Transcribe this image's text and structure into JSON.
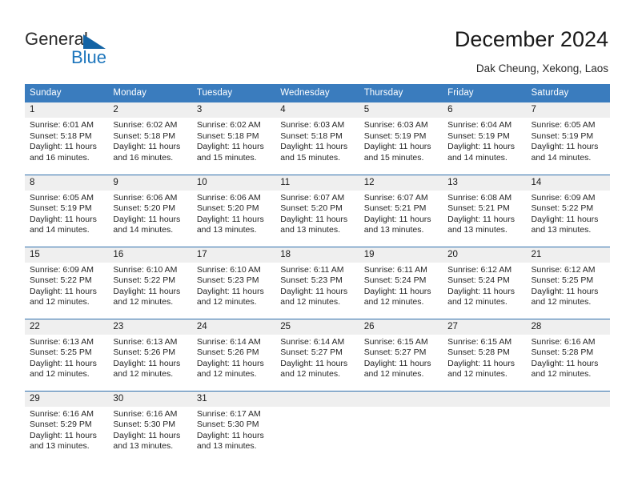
{
  "brand": {
    "name_part1": "General",
    "name_part2": "Blue",
    "triangle_icon": "brand-triangle-icon",
    "color_dark": "#2b2b2b",
    "color_blue": "#1c75bc"
  },
  "header": {
    "title": "December 2024",
    "subtitle": "Dak Cheung, Xekong, Laos",
    "accent_color": "#3a7cbe",
    "row_separator_color": "#2f6fad",
    "daynum_band_color": "#efefef"
  },
  "calendar": {
    "weekday_headers": [
      "Sunday",
      "Monday",
      "Tuesday",
      "Wednesday",
      "Thursday",
      "Friday",
      "Saturday"
    ],
    "weeks": [
      [
        {
          "day": "1",
          "sunrise": "Sunrise: 6:01 AM",
          "sunset": "Sunset: 5:18 PM",
          "daylight_line1": "Daylight: 11 hours",
          "daylight_line2": "and 16 minutes."
        },
        {
          "day": "2",
          "sunrise": "Sunrise: 6:02 AM",
          "sunset": "Sunset: 5:18 PM",
          "daylight_line1": "Daylight: 11 hours",
          "daylight_line2": "and 16 minutes."
        },
        {
          "day": "3",
          "sunrise": "Sunrise: 6:02 AM",
          "sunset": "Sunset: 5:18 PM",
          "daylight_line1": "Daylight: 11 hours",
          "daylight_line2": "and 15 minutes."
        },
        {
          "day": "4",
          "sunrise": "Sunrise: 6:03 AM",
          "sunset": "Sunset: 5:18 PM",
          "daylight_line1": "Daylight: 11 hours",
          "daylight_line2": "and 15 minutes."
        },
        {
          "day": "5",
          "sunrise": "Sunrise: 6:03 AM",
          "sunset": "Sunset: 5:19 PM",
          "daylight_line1": "Daylight: 11 hours",
          "daylight_line2": "and 15 minutes."
        },
        {
          "day": "6",
          "sunrise": "Sunrise: 6:04 AM",
          "sunset": "Sunset: 5:19 PM",
          "daylight_line1": "Daylight: 11 hours",
          "daylight_line2": "and 14 minutes."
        },
        {
          "day": "7",
          "sunrise": "Sunrise: 6:05 AM",
          "sunset": "Sunset: 5:19 PM",
          "daylight_line1": "Daylight: 11 hours",
          "daylight_line2": "and 14 minutes."
        }
      ],
      [
        {
          "day": "8",
          "sunrise": "Sunrise: 6:05 AM",
          "sunset": "Sunset: 5:19 PM",
          "daylight_line1": "Daylight: 11 hours",
          "daylight_line2": "and 14 minutes."
        },
        {
          "day": "9",
          "sunrise": "Sunrise: 6:06 AM",
          "sunset": "Sunset: 5:20 PM",
          "daylight_line1": "Daylight: 11 hours",
          "daylight_line2": "and 14 minutes."
        },
        {
          "day": "10",
          "sunrise": "Sunrise: 6:06 AM",
          "sunset": "Sunset: 5:20 PM",
          "daylight_line1": "Daylight: 11 hours",
          "daylight_line2": "and 13 minutes."
        },
        {
          "day": "11",
          "sunrise": "Sunrise: 6:07 AM",
          "sunset": "Sunset: 5:20 PM",
          "daylight_line1": "Daylight: 11 hours",
          "daylight_line2": "and 13 minutes."
        },
        {
          "day": "12",
          "sunrise": "Sunrise: 6:07 AM",
          "sunset": "Sunset: 5:21 PM",
          "daylight_line1": "Daylight: 11 hours",
          "daylight_line2": "and 13 minutes."
        },
        {
          "day": "13",
          "sunrise": "Sunrise: 6:08 AM",
          "sunset": "Sunset: 5:21 PM",
          "daylight_line1": "Daylight: 11 hours",
          "daylight_line2": "and 13 minutes."
        },
        {
          "day": "14",
          "sunrise": "Sunrise: 6:09 AM",
          "sunset": "Sunset: 5:22 PM",
          "daylight_line1": "Daylight: 11 hours",
          "daylight_line2": "and 13 minutes."
        }
      ],
      [
        {
          "day": "15",
          "sunrise": "Sunrise: 6:09 AM",
          "sunset": "Sunset: 5:22 PM",
          "daylight_line1": "Daylight: 11 hours",
          "daylight_line2": "and 12 minutes."
        },
        {
          "day": "16",
          "sunrise": "Sunrise: 6:10 AM",
          "sunset": "Sunset: 5:22 PM",
          "daylight_line1": "Daylight: 11 hours",
          "daylight_line2": "and 12 minutes."
        },
        {
          "day": "17",
          "sunrise": "Sunrise: 6:10 AM",
          "sunset": "Sunset: 5:23 PM",
          "daylight_line1": "Daylight: 11 hours",
          "daylight_line2": "and 12 minutes."
        },
        {
          "day": "18",
          "sunrise": "Sunrise: 6:11 AM",
          "sunset": "Sunset: 5:23 PM",
          "daylight_line1": "Daylight: 11 hours",
          "daylight_line2": "and 12 minutes."
        },
        {
          "day": "19",
          "sunrise": "Sunrise: 6:11 AM",
          "sunset": "Sunset: 5:24 PM",
          "daylight_line1": "Daylight: 11 hours",
          "daylight_line2": "and 12 minutes."
        },
        {
          "day": "20",
          "sunrise": "Sunrise: 6:12 AM",
          "sunset": "Sunset: 5:24 PM",
          "daylight_line1": "Daylight: 11 hours",
          "daylight_line2": "and 12 minutes."
        },
        {
          "day": "21",
          "sunrise": "Sunrise: 6:12 AM",
          "sunset": "Sunset: 5:25 PM",
          "daylight_line1": "Daylight: 11 hours",
          "daylight_line2": "and 12 minutes."
        }
      ],
      [
        {
          "day": "22",
          "sunrise": "Sunrise: 6:13 AM",
          "sunset": "Sunset: 5:25 PM",
          "daylight_line1": "Daylight: 11 hours",
          "daylight_line2": "and 12 minutes."
        },
        {
          "day": "23",
          "sunrise": "Sunrise: 6:13 AM",
          "sunset": "Sunset: 5:26 PM",
          "daylight_line1": "Daylight: 11 hours",
          "daylight_line2": "and 12 minutes."
        },
        {
          "day": "24",
          "sunrise": "Sunrise: 6:14 AM",
          "sunset": "Sunset: 5:26 PM",
          "daylight_line1": "Daylight: 11 hours",
          "daylight_line2": "and 12 minutes."
        },
        {
          "day": "25",
          "sunrise": "Sunrise: 6:14 AM",
          "sunset": "Sunset: 5:27 PM",
          "daylight_line1": "Daylight: 11 hours",
          "daylight_line2": "and 12 minutes."
        },
        {
          "day": "26",
          "sunrise": "Sunrise: 6:15 AM",
          "sunset": "Sunset: 5:27 PM",
          "daylight_line1": "Daylight: 11 hours",
          "daylight_line2": "and 12 minutes."
        },
        {
          "day": "27",
          "sunrise": "Sunrise: 6:15 AM",
          "sunset": "Sunset: 5:28 PM",
          "daylight_line1": "Daylight: 11 hours",
          "daylight_line2": "and 12 minutes."
        },
        {
          "day": "28",
          "sunrise": "Sunrise: 6:16 AM",
          "sunset": "Sunset: 5:28 PM",
          "daylight_line1": "Daylight: 11 hours",
          "daylight_line2": "and 12 minutes."
        }
      ],
      [
        {
          "day": "29",
          "sunrise": "Sunrise: 6:16 AM",
          "sunset": "Sunset: 5:29 PM",
          "daylight_line1": "Daylight: 11 hours",
          "daylight_line2": "and 13 minutes."
        },
        {
          "day": "30",
          "sunrise": "Sunrise: 6:16 AM",
          "sunset": "Sunset: 5:30 PM",
          "daylight_line1": "Daylight: 11 hours",
          "daylight_line2": "and 13 minutes."
        },
        {
          "day": "31",
          "sunrise": "Sunrise: 6:17 AM",
          "sunset": "Sunset: 5:30 PM",
          "daylight_line1": "Daylight: 11 hours",
          "daylight_line2": "and 13 minutes."
        },
        {
          "day": "",
          "sunrise": "",
          "sunset": "",
          "daylight_line1": "",
          "daylight_line2": ""
        },
        {
          "day": "",
          "sunrise": "",
          "sunset": "",
          "daylight_line1": "",
          "daylight_line2": ""
        },
        {
          "day": "",
          "sunrise": "",
          "sunset": "",
          "daylight_line1": "",
          "daylight_line2": ""
        },
        {
          "day": "",
          "sunrise": "",
          "sunset": "",
          "daylight_line1": "",
          "daylight_line2": ""
        }
      ]
    ]
  }
}
